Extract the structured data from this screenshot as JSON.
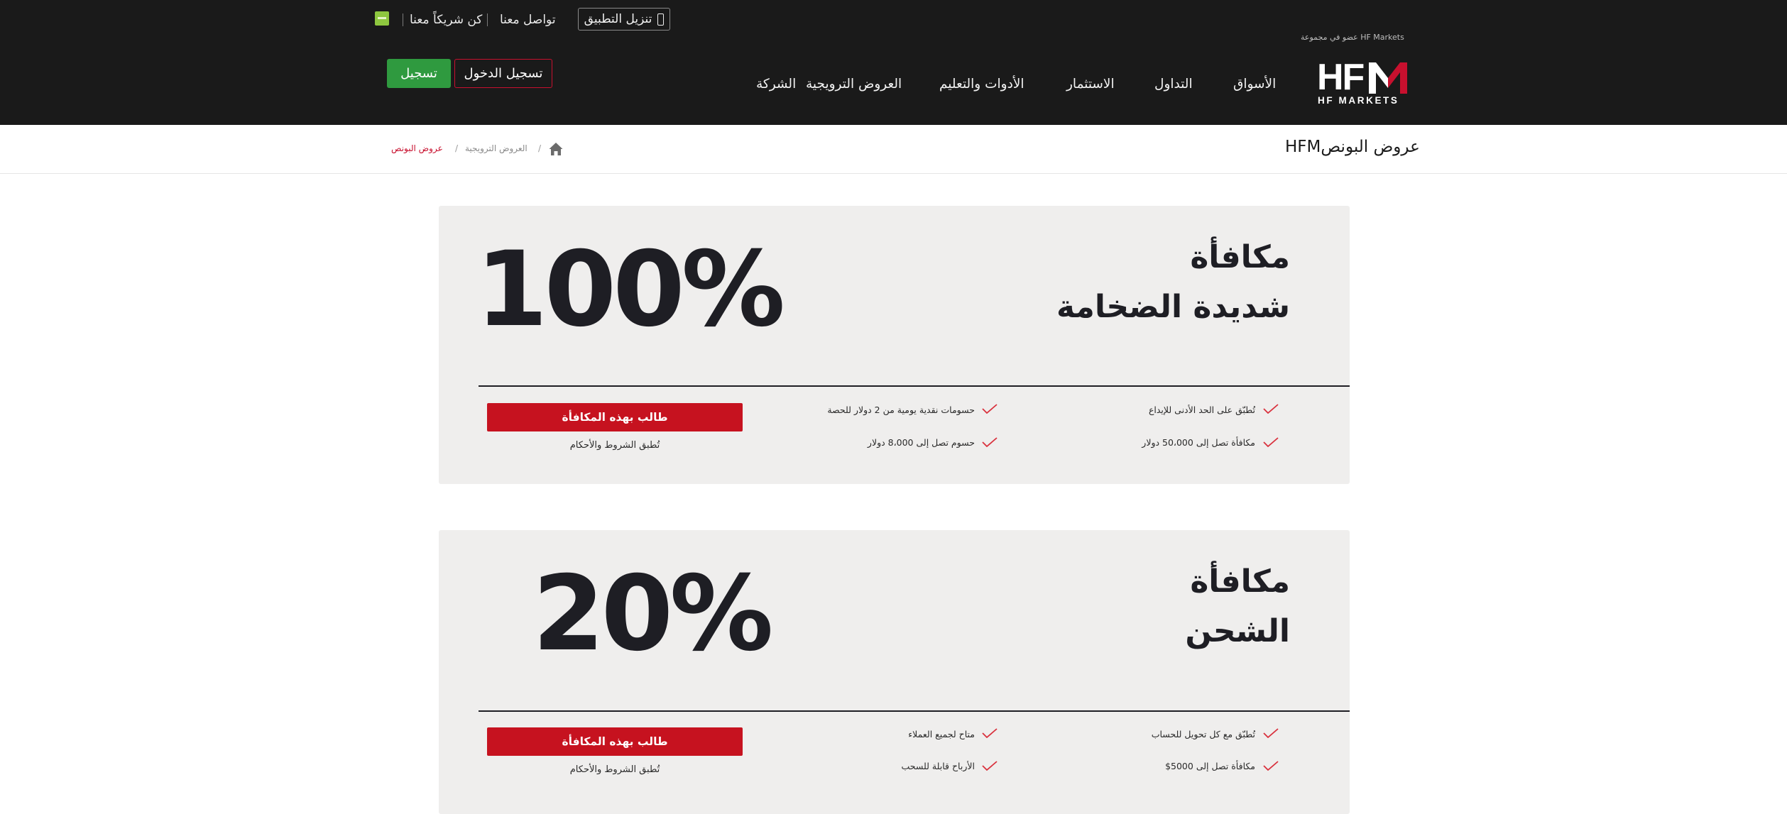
{
  "topbar": {
    "download_app": "تنزيل التطبيق",
    "contact": "تواصل معنا",
    "partner": "كن شريكاً معنا",
    "member_of": "عضو في مجموعة HF Markets"
  },
  "logo": {
    "main": "HF",
    "sub": "HF MARKETS"
  },
  "nav": {
    "items": [
      "الأسواق",
      "التداول",
      "الاستثمار",
      "الأدوات والتعليم",
      "العروض الترويجية",
      "الشركة"
    ],
    "login": "تسجيل الدخول",
    "register": "تسجيل"
  },
  "page": {
    "title": "عروض البونصHFM",
    "breadcrumb": [
      "العروض الترويجية",
      "عروض البونص"
    ]
  },
  "promos": [
    {
      "title_line1": "مكافأة",
      "title_line2": "شديدة الضخامة",
      "percent": "100%",
      "features_right": [
        "تُطبّق على الحد الأدنى للإيداع",
        "مكافأة تصل إلى 50،000 دولار"
      ],
      "features_left": [
        "حسومات نقدية يومية من 2 دولار للحصة",
        "حسوم تصل إلى 8،000 دولار"
      ],
      "cta": "طالب بهذه المكافأة",
      "terms": "تُطبق الشروط والأحكام"
    },
    {
      "title_line1": "مكافأة",
      "title_line2": "الشحن",
      "percent": "20%",
      "features_right": [
        "تُطبّق مع كل تحويل للحساب",
        "مكافأة تصل إلى 5000$"
      ],
      "features_left": [
        "متاح لجميع العملاء",
        "الأرباح قابلة للسحب"
      ],
      "cta": "طالب بهذه المكافأة",
      "terms": "تُطبق الشروط والأحكام"
    }
  ],
  "colors": {
    "brand_red": "#c6121f",
    "register_green": "#2f9a3f",
    "header_bg": "#1a1a1a",
    "card_bg": "#efeeed"
  }
}
